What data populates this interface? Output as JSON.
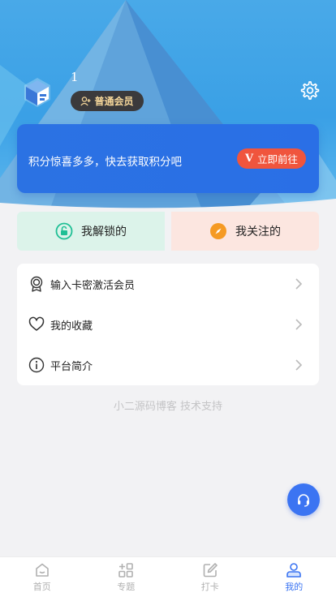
{
  "profile": {
    "username": "1",
    "member_badge": "普通会员",
    "avatar_icon": "cube-logo-icon",
    "settings_icon": "gear-icon"
  },
  "points_card": {
    "text": "积分惊喜多多，快去获取积分吧",
    "button_mark": "V",
    "button_label": "立即前往"
  },
  "quick_actions": [
    {
      "label": "我解锁的",
      "icon": "unlock-icon",
      "color": "#1fbf95"
    },
    {
      "label": "我关注的",
      "icon": "compass-icon",
      "color": "#f59a23"
    }
  ],
  "menu": {
    "items": [
      {
        "label": "输入卡密激活会员",
        "icon": "medal-icon"
      },
      {
        "label": "我的收藏",
        "icon": "heart-icon"
      },
      {
        "label": "平台简介",
        "icon": "info-icon"
      }
    ]
  },
  "footer_note": "小二源码博客 技术支持",
  "support_icon": "headset-icon",
  "tabbar": {
    "items": [
      {
        "label": "首页",
        "icon": "home-icon",
        "active": false
      },
      {
        "label": "专题",
        "icon": "grid-plus-icon",
        "active": false
      },
      {
        "label": "打卡",
        "icon": "edit-icon",
        "active": false
      },
      {
        "label": "我的",
        "icon": "user-icon",
        "active": true
      }
    ]
  },
  "colors": {
    "accent": "#3b74f2",
    "card": "#2a6fe6",
    "go_button": "#f0553d"
  }
}
